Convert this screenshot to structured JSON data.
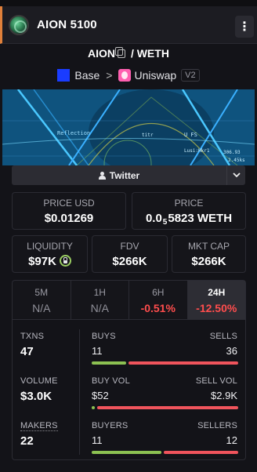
{
  "header": {
    "title": "AION 5100",
    "logo_icon": "aion-logo-icon",
    "menu_icon": "vertical-dots-icon"
  },
  "pair": {
    "base_token": "AION",
    "separator": "/",
    "quote_token": "WETH",
    "copy_icon": "copy-icon"
  },
  "chain": {
    "network": "Base",
    "separator": ">",
    "dex": "Uniswap",
    "version": "V2"
  },
  "banner": {
    "overlay_texts": [
      "Reflection",
      "titr",
      "U FS",
      "Lusi:Hkr1",
      "306.93 MHz",
      "2.45ks"
    ]
  },
  "social": {
    "twitter_label": "Twitter"
  },
  "price_usd": {
    "label": "PRICE USD",
    "value": "$0.01269"
  },
  "price_native": {
    "label": "PRICE",
    "prefix": "0.0",
    "subscript": "5",
    "suffix": "5823 WETH"
  },
  "liquidity": {
    "label": "LIQUIDITY",
    "value": "$97K"
  },
  "fdv": {
    "label": "FDV",
    "value": "$266K"
  },
  "mktcap": {
    "label": "MKT CAP",
    "value": "$266K"
  },
  "timeframes": [
    {
      "label": "5M",
      "value": "N/A",
      "negative": false,
      "active": false
    },
    {
      "label": "1H",
      "value": "N/A",
      "negative": false,
      "active": false
    },
    {
      "label": "6H",
      "value": "-0.51%",
      "negative": true,
      "active": false
    },
    {
      "label": "24H",
      "value": "-12.50%",
      "negative": true,
      "active": true
    }
  ],
  "stats": {
    "txns": {
      "label": "TXNS",
      "value": "47"
    },
    "buys": {
      "label": "BUYS",
      "value": "11"
    },
    "sells": {
      "label": "SELLS",
      "value": "36"
    },
    "volume": {
      "label": "VOLUME",
      "value": "$3.0K"
    },
    "buy_vol": {
      "label": "BUY VOL",
      "value": "$52"
    },
    "sell_vol": {
      "label": "SELL VOL",
      "value": "$2.9K"
    },
    "makers": {
      "label": "MAKERS",
      "value": "22"
    },
    "buyers": {
      "label": "BUYERS",
      "value": "11"
    },
    "sellers": {
      "label": "SELLERS",
      "value": "12"
    }
  },
  "ratios": {
    "buys_share": 0.234,
    "buy_vol_share": 0.018,
    "buyers_share": 0.478
  },
  "colors": {
    "accent": "#e0803a",
    "positive": "#8cc152",
    "negative": "#f0545c",
    "base": "#1a3cff",
    "uniswap": "#ff5fb0"
  }
}
